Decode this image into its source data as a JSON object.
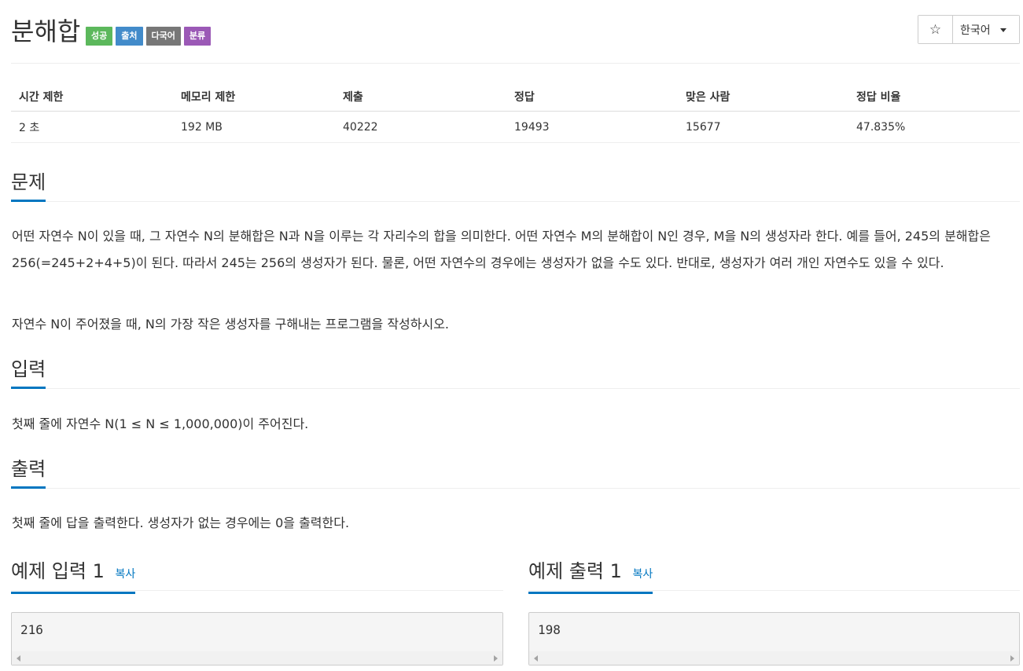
{
  "problem": {
    "title": "분해합",
    "badges": [
      {
        "label": "성공",
        "color": "#5cb85c"
      },
      {
        "label": "출처",
        "color": "#428bca"
      },
      {
        "label": "다국어",
        "color": "#777777"
      },
      {
        "label": "분류",
        "color": "#9b59b6"
      }
    ]
  },
  "toolbar": {
    "star_icon": "star-icon",
    "star_glyph": "☆",
    "language": "한국어"
  },
  "info_table": {
    "headers": [
      "시간 제한",
      "메모리 제한",
      "제출",
      "정답",
      "맞은 사람",
      "정답 비율"
    ],
    "values": [
      "2 초",
      "192 MB",
      "40222",
      "19493",
      "15677",
      "47.835%"
    ]
  },
  "sections": {
    "description": {
      "title": "문제",
      "paragraphs": [
        "어떤 자연수 N이 있을 때, 그 자연수 N의 분해합은 N과 N을 이루는 각 자리수의 합을 의미한다. 어떤 자연수 M의 분해합이 N인 경우, M을 N의 생성자라 한다. 예를 들어, 245의 분해합은 256(=245+2+4+5)이 된다. 따라서 245는 256의 생성자가 된다. 물론, 어떤 자연수의 경우에는 생성자가 없을 수도 있다. 반대로, 생성자가 여러 개인 자연수도 있을 수 있다.",
        "자연수 N이 주어졌을 때, N의 가장 작은 생성자를 구해내는 프로그램을 작성하시오."
      ]
    },
    "input": {
      "title": "입력",
      "text": "첫째 줄에 자연수 N(1 ≤ N ≤ 1,000,000)이 주어진다."
    },
    "output": {
      "title": "출력",
      "text": "첫째 줄에 답을 출력한다. 생성자가 없는 경우에는 0을 출력한다."
    }
  },
  "examples": {
    "input": {
      "title": "예제 입력 1",
      "copy": "복사",
      "value": "216"
    },
    "output": {
      "title": "예제 출력 1",
      "copy": "복사",
      "value": "198"
    }
  },
  "colors": {
    "accent": "#0076c0"
  }
}
